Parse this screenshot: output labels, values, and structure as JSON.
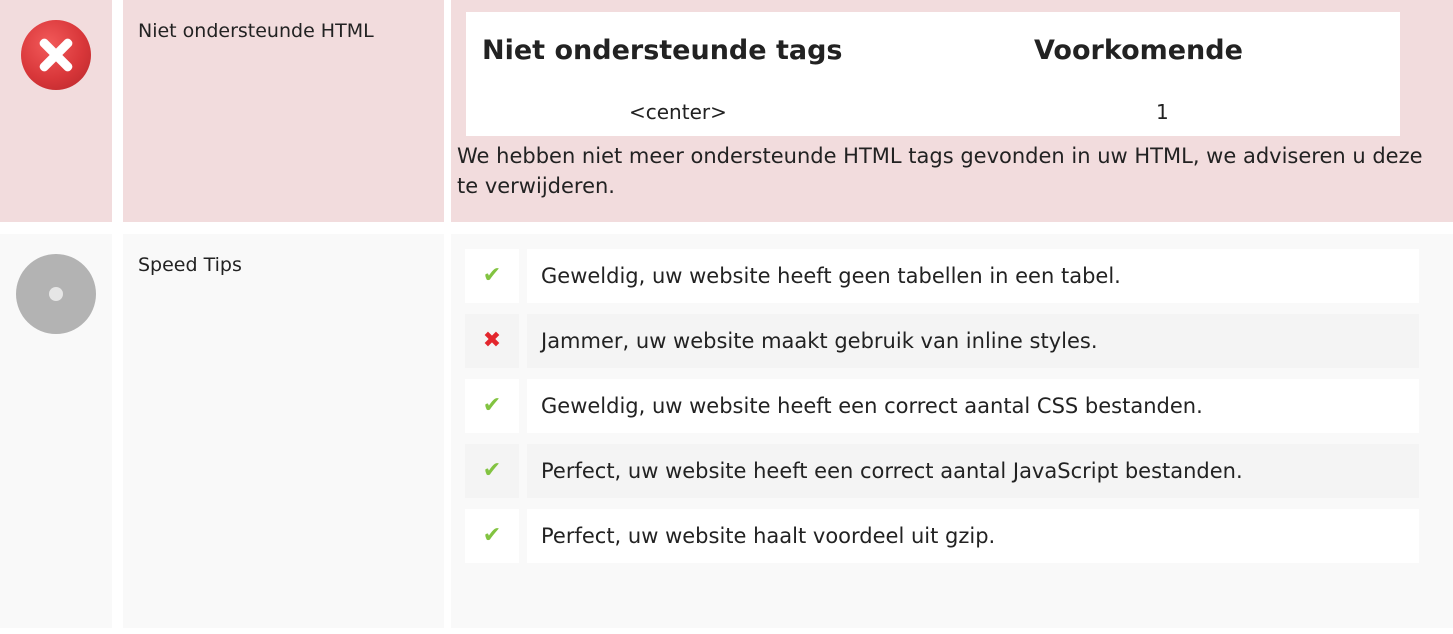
{
  "sections": {
    "unsupported_html": {
      "label": "Niet ondersteunde HTML",
      "status_icon": "error-x-icon",
      "table": {
        "headers": [
          "Niet ondersteunde tags",
          "Voorkomende"
        ],
        "rows": [
          [
            "<center>",
            "1"
          ]
        ]
      },
      "note": "We hebben niet meer ondersteunde HTML tags gevonden in uw HTML, we adviseren u deze te verwijderen."
    },
    "speed_tips": {
      "label": "Speed Tips",
      "status_icon": "neutral-circle-icon",
      "items": [
        {
          "status": "ok",
          "icon": "check-icon",
          "text": "Geweldig, uw website heeft geen tabellen in een tabel."
        },
        {
          "status": "bad",
          "icon": "cross-icon",
          "text": "Jammer, uw website maakt gebruik van inline styles."
        },
        {
          "status": "ok",
          "icon": "check-icon",
          "text": "Geweldig, uw website heeft een correct aantal CSS bestanden."
        },
        {
          "status": "ok",
          "icon": "check-icon",
          "text": "Perfect, uw website heeft een correct aantal JavaScript bestanden."
        },
        {
          "status": "ok",
          "icon": "check-icon",
          "text": "Perfect, uw website haalt voordeel uit gzip."
        }
      ]
    }
  },
  "colors": {
    "error_bg": "#f2dcdd",
    "neutral_bg": "#f9f9f9",
    "ok": "#82c341",
    "bad": "#e3262d"
  }
}
